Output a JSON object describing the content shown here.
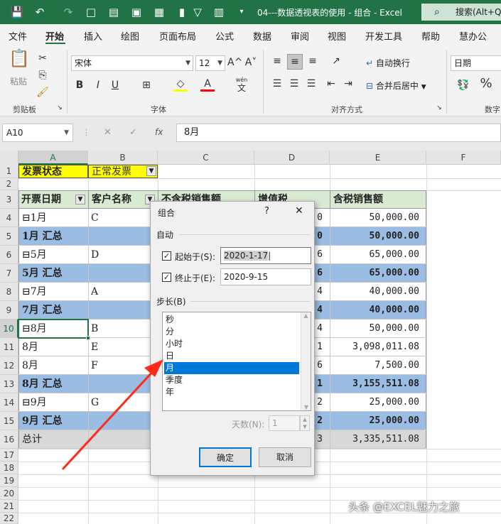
{
  "window": {
    "title": "04---数据透视表的使用 - 组合  -  Excel",
    "search_placeholder": "搜索(Alt+Q)"
  },
  "icons": [
    "save-icon",
    "undo-icon",
    "redo-icon",
    "paste-icon",
    "filter-icon",
    "sort-icon",
    "search-icon",
    "cut-icon",
    "copy-icon",
    "format-painter-icon",
    "close-icon"
  ],
  "menu": [
    "文件",
    "开始",
    "插入",
    "绘图",
    "页面布局",
    "公式",
    "数据",
    "审阅",
    "视图",
    "开发工具",
    "帮助",
    "慧办公"
  ],
  "ribbon": {
    "clipboard": {
      "paste": "粘贴",
      "group": "剪贴板"
    },
    "font": {
      "name": "宋体",
      "size": "12",
      "bold": "B",
      "italic": "I",
      "underline": "U",
      "group": "字体",
      "wen": "wén",
      "wen_char": "文",
      "grow": "A^",
      "shrink": "A˅"
    },
    "align": {
      "wrap": "自动换行",
      "merge": "合并后居中",
      "group": "对齐方式"
    },
    "number": {
      "format": "日期",
      "percent": "%",
      "group": "数字"
    }
  },
  "formula_bar": {
    "name_box": "A10",
    "cancel": "✕",
    "enter": "✓",
    "fx": "fx",
    "content": "8月"
  },
  "columns": [
    "A",
    "B",
    "C",
    "D",
    "E",
    "F"
  ],
  "rows": [
    "1",
    "2",
    "3",
    "4",
    "5",
    "6",
    "7",
    "8",
    "9",
    "10",
    "11",
    "12",
    "13",
    "14",
    "15",
    "16",
    "17",
    "18",
    "19",
    "20",
    "21",
    "22"
  ],
  "sheet": {
    "filter_label": "发票状态",
    "filter_value": "正常发票",
    "headers": [
      "开票日期",
      "客户名称",
      "不含税销售额",
      "增值税",
      "含税销售额"
    ],
    "rows": [
      {
        "a": "⊟1月",
        "b": "C",
        "d": "0",
        "e": "50,000.00"
      },
      {
        "a": "1月 汇总",
        "d": "0",
        "e": "50,000.00"
      },
      {
        "a": "⊟5月",
        "b": "D",
        "d": "6",
        "e": "65,000.00"
      },
      {
        "a": "5月 汇总",
        "d": "6",
        "e": "65,000.00"
      },
      {
        "a": "⊟7月",
        "b": "A",
        "d": "4",
        "e": "40,000.00"
      },
      {
        "a": "7月 汇总",
        "d": "4",
        "e": "40,000.00"
      },
      {
        "a": "⊟8月",
        "b": "B",
        "d": "4",
        "e": "50,000.00"
      },
      {
        "a": "8月",
        "b": "E",
        "d": "1",
        "e": "3,098,011.08"
      },
      {
        "a": "8月",
        "b": "F",
        "d": "6",
        "e": "7,500.00"
      },
      {
        "a": "8月 汇总",
        "d": "1",
        "e": "3,155,511.08"
      },
      {
        "a": "⊟9月",
        "b": "G",
        "d": "2",
        "e": "25,000.00"
      },
      {
        "a": "9月 汇总",
        "d": "2",
        "e": "25,000.00"
      },
      {
        "a": "总计",
        "d": "3",
        "e": "3,335,511.08"
      }
    ]
  },
  "dialog": {
    "title": "组合",
    "help": "?",
    "close": "✕",
    "auto_label": "自动",
    "start_label": "起始于(S):",
    "start_value": "2020-1-17",
    "end_label": "终止于(E):",
    "end_value": "2020-9-15",
    "step_label": "步长(B)",
    "options": [
      "秒",
      "分",
      "小时",
      "日",
      "月",
      "季度",
      "年"
    ],
    "selected_option": "月",
    "days_label": "天数(N):",
    "days_value": "1",
    "ok": "确定",
    "cancel": "取消"
  },
  "watermark": "头条 @EXCEL魅力之旅",
  "colors": {
    "excel_green": "#217346",
    "subtotal_blue": "#9cbde3",
    "header_green": "#d9ead3",
    "arrow_red": "#ff2a1a",
    "selection_blue": "#0078d7"
  }
}
